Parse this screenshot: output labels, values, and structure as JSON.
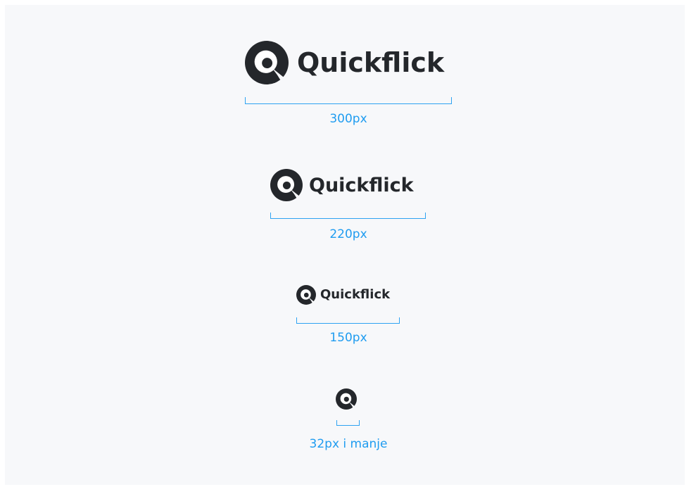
{
  "brand": {
    "name": "Quickflick",
    "icon": "quickflick-logo-icon",
    "text_color": "#24272b",
    "accent_color": "#2ea3f2"
  },
  "variants": [
    {
      "label": "300px",
      "show_wordmark": true
    },
    {
      "label": "220px",
      "show_wordmark": true
    },
    {
      "label": "150px",
      "show_wordmark": true
    },
    {
      "label": "32px i manje",
      "show_wordmark": false
    }
  ]
}
